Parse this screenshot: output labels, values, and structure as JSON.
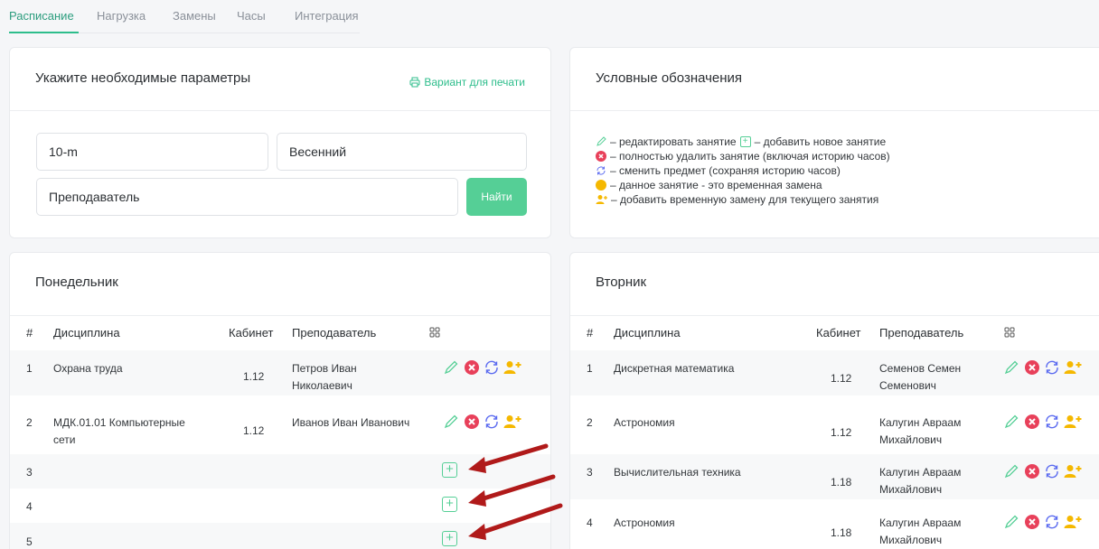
{
  "tabs": [
    {
      "label": "Расписание",
      "active": true
    },
    {
      "label": "Нагрузка",
      "active": false
    },
    {
      "label": "Замены",
      "active": false
    },
    {
      "label": "Часы",
      "active": false
    },
    {
      "label": "Интеграция",
      "active": false
    }
  ],
  "params": {
    "title": "Укажите необходимые параметры",
    "print_label": "Вариант для печати",
    "group_value": "10-m",
    "semester_value": "Весенний",
    "teacher_value": "Преподаватель",
    "find_label": "Найти"
  },
  "legend": {
    "title": "Условные обозначения",
    "edit_text": "– редактировать занятие",
    "add_text": "– добавить новое занятие",
    "delete_text": "– полностью удалить занятие (включая историю часов)",
    "change_text": "– сменить предмет (сохраняя историю часов)",
    "temp_text": "– данное занятие - это временная замена",
    "substitute_text": "– добавить временную замену для текущего занятия"
  },
  "columns": {
    "num": "#",
    "discipline": "Дисциплина",
    "room": "Кабинет",
    "teacher": "Преподаватель"
  },
  "monday": {
    "title": "Понедельник",
    "rows": [
      {
        "num": "1",
        "discipline": "Охрана труда",
        "room": "1.12",
        "teacher": "Петров Иван Николаевич"
      },
      {
        "num": "2",
        "discipline": "МДК.01.01 Компьютерные сети",
        "room": "1.12",
        "teacher": "Иванов Иван Иванович"
      },
      {
        "num": "3",
        "discipline": "",
        "room": "",
        "teacher": ""
      },
      {
        "num": "4",
        "discipline": "",
        "room": "",
        "teacher": ""
      },
      {
        "num": "5",
        "discipline": "",
        "room": "",
        "teacher": ""
      }
    ]
  },
  "tuesday": {
    "title": "Вторник",
    "rows": [
      {
        "num": "1",
        "discipline": "Дискретная математика",
        "room": "1.12",
        "teacher": "Семенов Семен Семенович"
      },
      {
        "num": "2",
        "discipline": "Астрономия",
        "room": "1.12",
        "teacher": "Калугин Авраам Михайлович"
      },
      {
        "num": "3",
        "discipline": "Вычислительная техника",
        "room": "1.18",
        "teacher": "Калугин Авраам Михайлович"
      },
      {
        "num": "4",
        "discipline": "Астрономия",
        "room": "1.18",
        "teacher": "Калугин Авраам Михайлович"
      }
    ]
  },
  "colors": {
    "accent": "#2dbd8b",
    "button": "#55cf96",
    "delete": "#e8405a",
    "change": "#5b6bf0",
    "substitute": "#f5b800",
    "arrow": "#b01a1a"
  }
}
